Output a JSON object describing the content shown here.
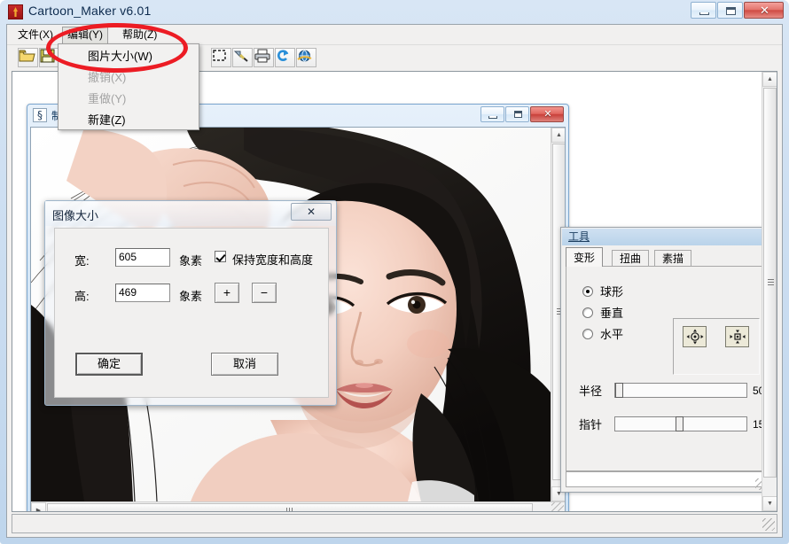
{
  "window": {
    "title": "Cartoon_Maker v6.01",
    "icon": "app-icon",
    "buttons": {
      "minimize": "minimize-icon",
      "maximize": "maximize-icon",
      "close": "✕"
    }
  },
  "menubar": {
    "items": [
      {
        "label": "文件(X)",
        "active": false
      },
      {
        "label": "编辑(Y)",
        "active": true
      },
      {
        "label": "帮助(Z)",
        "active": false
      }
    ]
  },
  "dropdown": {
    "items": [
      {
        "label": "图片大小(W)",
        "disabled": false
      },
      {
        "label": "撤销(X)",
        "disabled": true
      },
      {
        "label": "重做(Y)",
        "disabled": true
      },
      {
        "label": "新建(Z)",
        "disabled": false
      }
    ]
  },
  "toolbar": {
    "left_buttons": [
      {
        "name": "open-icon"
      },
      {
        "name": "save-icon"
      }
    ],
    "right_buttons": [
      {
        "name": "marquee-select-icon"
      },
      {
        "name": "wand-icon"
      },
      {
        "name": "print-icon"
      },
      {
        "name": "refresh-icon"
      },
      {
        "name": "browser-icon"
      }
    ]
  },
  "child_window": {
    "title": "制作",
    "icon": "document-icon",
    "buttons": {
      "minimize": "minimize-icon",
      "maximize": "maximize-icon",
      "close": "✕"
    }
  },
  "tools_panel": {
    "caption": "工具",
    "tabs": [
      {
        "label": "变形",
        "selected": true
      },
      {
        "label": "扭曲",
        "selected": false
      },
      {
        "label": "素描",
        "selected": false
      }
    ],
    "radios": [
      {
        "label": "球形",
        "checked": true
      },
      {
        "label": "垂直",
        "checked": false
      },
      {
        "label": "水平",
        "checked": false
      }
    ],
    "tool_buttons": [
      {
        "name": "expand-tool-icon"
      },
      {
        "name": "contract-tool-icon"
      }
    ],
    "sliders": [
      {
        "label": "半径",
        "value": "50",
        "position_pct": 2
      },
      {
        "label": "指针",
        "value": "15",
        "position_pct": 47
      }
    ],
    "status_text": ""
  },
  "dialog": {
    "title": "图像大小",
    "close_label": "✕",
    "width_label": "宽:",
    "width_value": "605",
    "width_unit": "象素",
    "height_label": "高:",
    "height_value": "469",
    "height_unit": "象素",
    "keep_ratio_label": "保持宽度和高度",
    "keep_ratio_checked": true,
    "plus_label": "+",
    "minus_label": "−",
    "ok_label": "确定",
    "cancel_label": "取消"
  },
  "statusbar": {
    "text": ""
  },
  "annotation": {
    "shape": "red-ellipse",
    "color": "#ec1c24"
  },
  "colors": {
    "accent": "#1a3c5e",
    "annotation_red": "#ec1c24",
    "close_red": "#cf4a42",
    "panel_face": "#f1f0ef"
  }
}
